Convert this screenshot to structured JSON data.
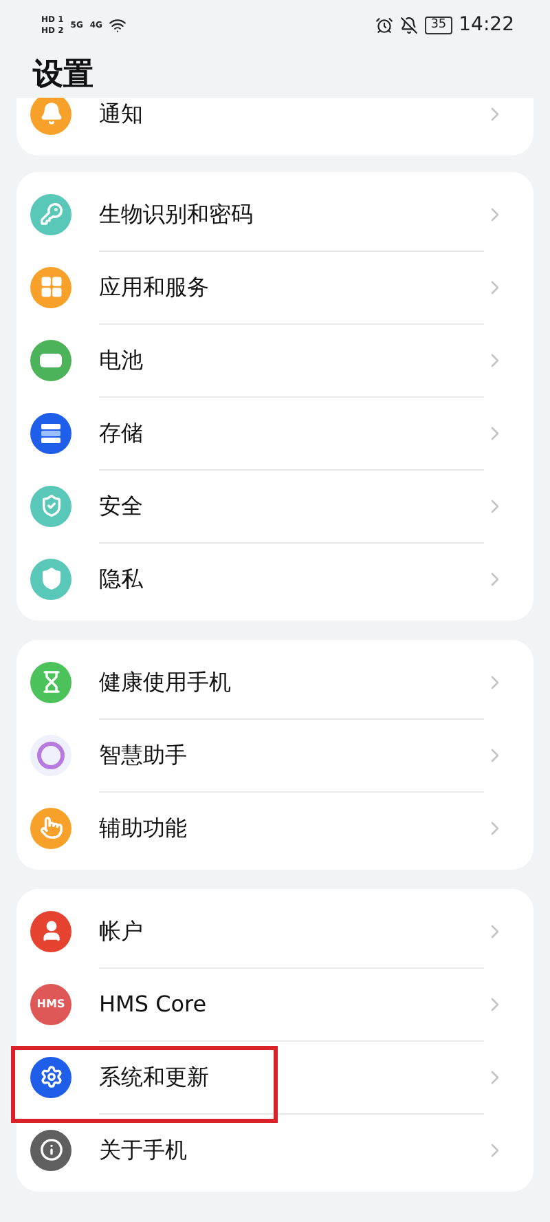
{
  "status_bar": {
    "sim_badges": [
      "HD 1",
      "HD 2"
    ],
    "networks": [
      "5G",
      "4G"
    ],
    "battery": "35",
    "time": "14:22"
  },
  "title": "设置",
  "groups": [
    {
      "clipped": true,
      "items": [
        {
          "kind": "bell",
          "label": "通知",
          "highlighted": false
        }
      ]
    },
    {
      "clipped": false,
      "items": [
        {
          "kind": "key",
          "label": "生物识别和密码",
          "highlighted": false
        },
        {
          "kind": "apps",
          "label": "应用和服务",
          "highlighted": false
        },
        {
          "kind": "battery",
          "label": "电池",
          "highlighted": false
        },
        {
          "kind": "storage",
          "label": "存储",
          "highlighted": false
        },
        {
          "kind": "shield",
          "label": "安全",
          "highlighted": false
        },
        {
          "kind": "privacy",
          "label": "隐私",
          "highlighted": false
        }
      ]
    },
    {
      "clipped": false,
      "items": [
        {
          "kind": "hourglass",
          "label": "健康使用手机",
          "highlighted": false
        },
        {
          "kind": "ring",
          "label": "智慧助手",
          "highlighted": false
        },
        {
          "kind": "hand",
          "label": "辅助功能",
          "highlighted": false
        }
      ]
    },
    {
      "clipped": false,
      "items": [
        {
          "kind": "user",
          "label": "帐户",
          "highlighted": false
        },
        {
          "kind": "hms",
          "icon_text": "HMS",
          "label": "HMS Core",
          "highlighted": false
        },
        {
          "kind": "gear",
          "label": "系统和更新",
          "highlighted": true
        },
        {
          "kind": "info",
          "label": "关于手机",
          "highlighted": false
        }
      ]
    }
  ]
}
